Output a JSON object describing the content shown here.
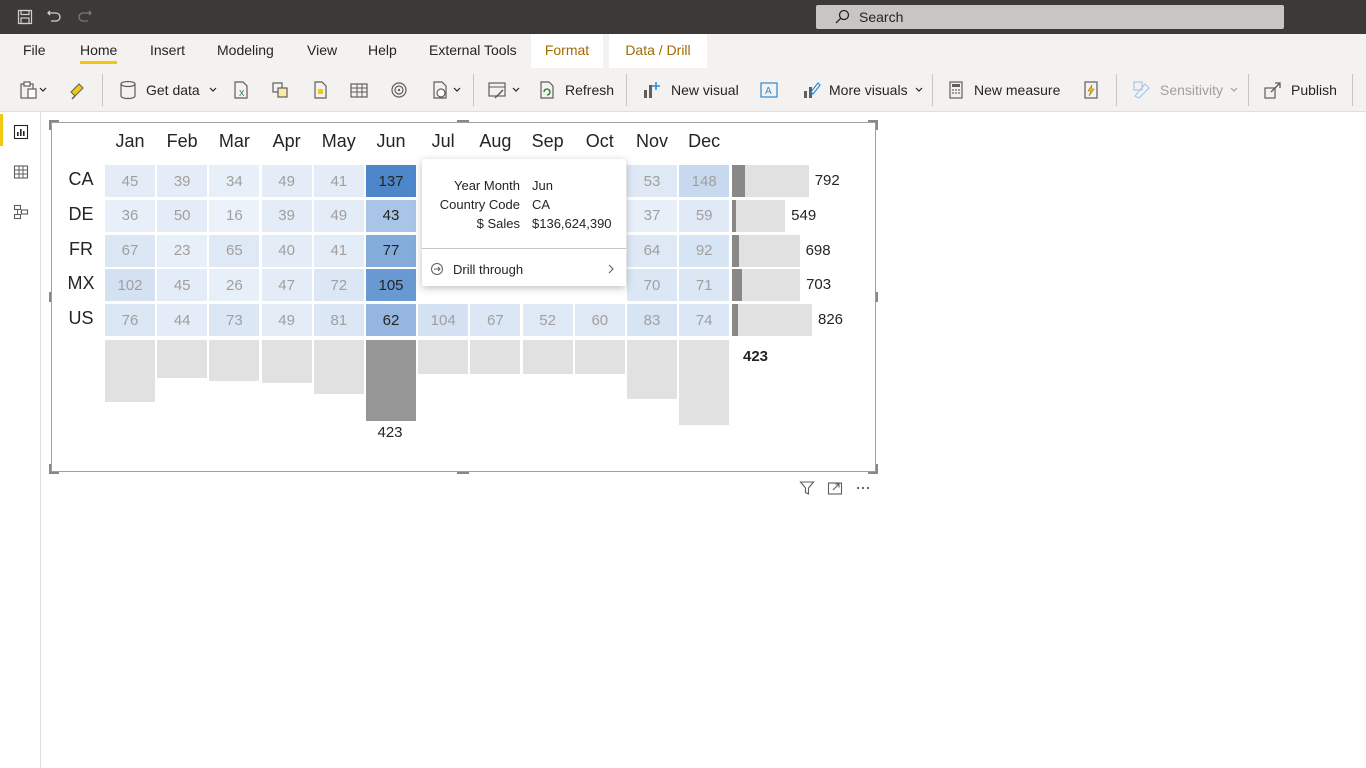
{
  "titlebar": {
    "search_label": "Search"
  },
  "menu": {
    "tabs": [
      "File",
      "Home",
      "Insert",
      "Modeling",
      "View",
      "Help",
      "External Tools",
      "Format",
      "Data / Drill"
    ],
    "active": "Home"
  },
  "ribbon": {
    "get_data": "Get data",
    "refresh": "Refresh",
    "new_visual": "New visual",
    "more_visuals": "More visuals",
    "new_measure": "New measure",
    "sensitivity": "Sensitivity",
    "publish": "Publish"
  },
  "colors": {
    "accent": "#f2c811",
    "highlight_cell": "#6d9bd1",
    "bar": "#e1e1e1",
    "bar_highlight": "#969696"
  },
  "chart_data": {
    "type": "heatmap",
    "months": [
      "Jan",
      "Feb",
      "Mar",
      "Apr",
      "May",
      "Jun",
      "Jul",
      "Aug",
      "Sep",
      "Oct",
      "Nov",
      "Dec"
    ],
    "countries": [
      "CA",
      "DE",
      "FR",
      "MX",
      "US"
    ],
    "values": [
      [
        45,
        39,
        34,
        49,
        41,
        137,
        null,
        null,
        null,
        null,
        53,
        148
      ],
      [
        36,
        50,
        16,
        39,
        49,
        43,
        null,
        null,
        null,
        null,
        37,
        59
      ],
      [
        67,
        23,
        65,
        40,
        41,
        77,
        null,
        null,
        null,
        null,
        64,
        92
      ],
      [
        102,
        45,
        26,
        47,
        72,
        105,
        null,
        null,
        null,
        null,
        70,
        71
      ],
      [
        76,
        44,
        73,
        49,
        81,
        62,
        104,
        67,
        52,
        60,
        83,
        74
      ]
    ],
    "row_totals": [
      792,
      549,
      698,
      703,
      826
    ],
    "highlighted_month": "Jun",
    "highlighted_month_total": 423,
    "highlighted_row_label": "423"
  },
  "tooltip": {
    "rows": [
      {
        "key": "Year Month",
        "value": "Jun"
      },
      {
        "key": "Country Code",
        "value": "CA"
      },
      {
        "key": "$ Sales",
        "value": "$136,624,390"
      }
    ],
    "drill_through": "Drill through"
  }
}
